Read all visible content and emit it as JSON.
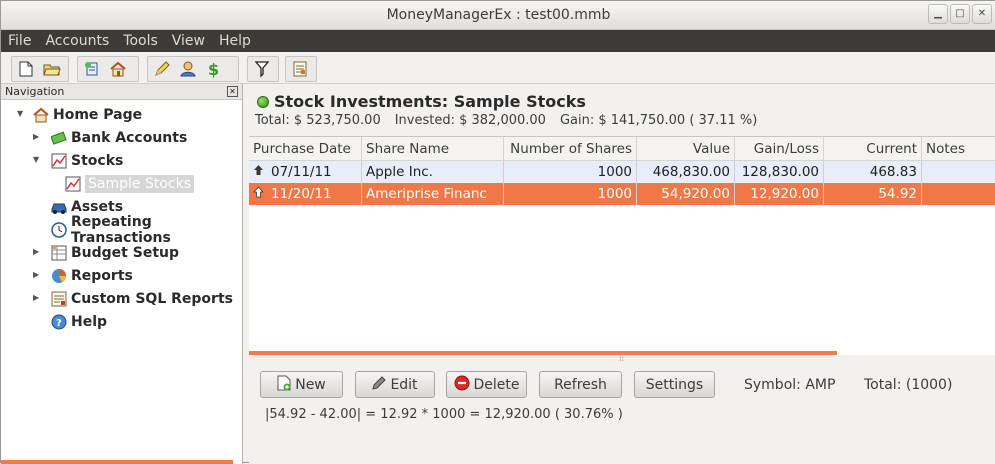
{
  "window": {
    "title": "MoneyManagerEx : test00.mmb"
  },
  "menu": [
    "File",
    "Accounts",
    "Tools",
    "View",
    "Help"
  ],
  "toolbar": {
    "icons": [
      "new-database-icon",
      "open-database-icon",
      "new-account-icon",
      "home-icon",
      "transaction-icon",
      "organize-payees-icon",
      "currency-icon",
      "filter-icon",
      "report-icon"
    ]
  },
  "navigation": {
    "header": "Navigation",
    "items": [
      {
        "label": "Home Page",
        "icon": "home-icon",
        "arrow": "▼"
      },
      {
        "label": "Bank Accounts",
        "icon": "bank-icon",
        "arrow": "▶"
      },
      {
        "label": "Stocks",
        "icon": "stocks-icon",
        "arrow": "▼"
      },
      {
        "label": "Sample Stocks",
        "icon": "stock-chart-icon",
        "arrow": ""
      },
      {
        "label": "Assets",
        "icon": "car-icon",
        "arrow": ""
      },
      {
        "label": "Repeating Transactions",
        "icon": "clock-icon",
        "arrow": ""
      },
      {
        "label": "Budget Setup",
        "icon": "budget-icon",
        "arrow": "▶"
      },
      {
        "label": "Reports",
        "icon": "pie-chart-icon",
        "arrow": "▶"
      },
      {
        "label": "Custom SQL Reports",
        "icon": "sql-report-icon",
        "arrow": "▶"
      },
      {
        "label": "Help",
        "icon": "help-icon",
        "arrow": ""
      }
    ]
  },
  "main": {
    "title": "Stock Investments: Sample Stocks",
    "summary": {
      "total": "Total: $ 523,750.00",
      "invested": "Invested: $ 382,000.00",
      "gain": "Gain: $ 141,750.00  ( 37.11 %)"
    },
    "columns": [
      "Purchase Date",
      "Share Name",
      "Number of Shares",
      "Value",
      "Gain/Loss",
      "Current",
      "Notes"
    ],
    "rows": [
      {
        "date": "07/11/11",
        "name": "Apple Inc.",
        "shares": "1000",
        "value": "468,830.00",
        "gain": "128,830.00",
        "current": "468.83",
        "notes": ""
      },
      {
        "date": "11/20/11",
        "name": "Ameriprise Financ",
        "shares": "1000",
        "value": "54,920.00",
        "gain": "12,920.00",
        "current": "54.92",
        "notes": ""
      }
    ],
    "buttons": {
      "new": "New",
      "edit": "Edit",
      "delete": "Delete",
      "refresh": "Refresh",
      "settings": "Settings"
    },
    "symbol": "Symbol: AMP",
    "total_shares": "Total: (1000)",
    "formula": "|54.92 - 42.00| = 12.92 * 1000 = 12,920.00 ( 30.76% )"
  }
}
